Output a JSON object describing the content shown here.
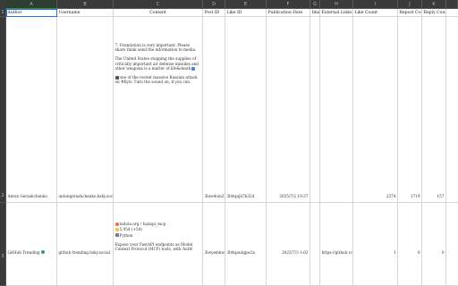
{
  "columns": [
    "A",
    "B",
    "C",
    "D",
    "E",
    "F",
    "G",
    "H",
    "I",
    "J",
    "K"
  ],
  "selected_column": "A",
  "headers": [
    "Author",
    "Username",
    "Content",
    "Post ID",
    "Like ID",
    "Publication Date",
    "Imag",
    "External Links",
    "Like Count",
    "Repost Cou",
    "Reply Count"
  ],
  "row_numbers": [
    "1",
    "2",
    "3"
  ],
  "rows": [
    {
      "author": "Anton Gerashchenko",
      "username": "antongerashchenko.bsky.social",
      "content": [
        "7. Foundation is very important. Please share",
        "think send the information to media.",
        "The United States stopping the supplies of critically important air defense missiles and other weapons is a matter of life&death",
        "one of the recent massive Russian attack on #Kyiv. Turn the sound on, if you can."
      ],
      "post_id": "3lwe4oin3k2",
      "like_id": "3lt4qojh7b32d",
      "publication_date": "2025/7/2 19:37",
      "image": "",
      "external_links": "",
      "like_count": "2374",
      "repost_count": "1719",
      "reply_count": "157"
    },
    {
      "author": "GitHub Trending",
      "username": "github-trending.bsky.social",
      "content": [
        "tadata.org / fastapi_mcp",
        "5,954 (+54)",
        "Python",
        "Expose your FastAPI endpoints as Model Context Protocol (MCP) tools, with Auth!"
      ],
      "post_id": "3lwyemkwes",
      "like_id": "3lt4qaulqpw2x",
      "publication_date": "2025/7/3 1:02",
      "image": "",
      "external_links": "https://github.co",
      "like_count": "1",
      "repost_count": "0",
      "reply_count": "0"
    }
  ],
  "colors": {
    "header_bg": "#3a3a3a",
    "selected_col_bg": "#2f3e33",
    "selected_col_text": "#86d08f",
    "gridline": "#d6d6d6",
    "active_cell_border": "#1a73e8"
  }
}
